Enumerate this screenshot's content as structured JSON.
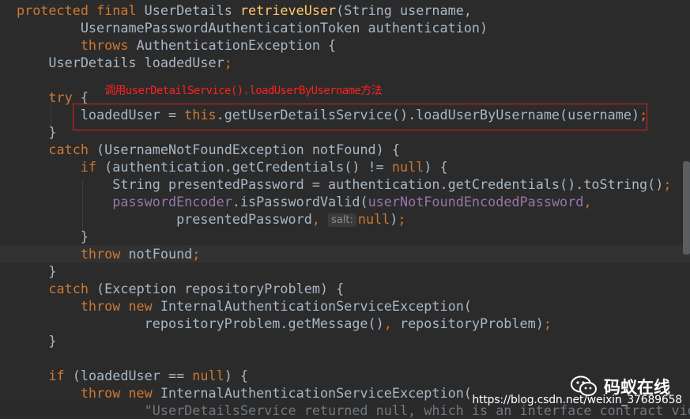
{
  "annotation": "调用userDetailService().loadUserByUsername方法",
  "brand": {
    "name": "码蚁在线",
    "icon": "wechat-icon"
  },
  "watermark": "https://blog.csdn.net/weixin_37689658",
  "colors": {
    "keyword": "#cc7832",
    "method_decl": "#ffc66d",
    "field": "#9876aa",
    "text": "#a9b7c6",
    "highlight_box": "#e02020"
  },
  "code": [
    {
      "segs": [
        {
          "t": "protected final ",
          "c": "kw"
        },
        {
          "t": "UserDetails "
        },
        {
          "t": "retrieveUser",
          "c": "fn"
        },
        {
          "t": "(String username,"
        }
      ]
    },
    {
      "segs": [
        {
          "t": "        UsernamePasswordAuthenticationToken authentication)"
        }
      ]
    },
    {
      "segs": [
        {
          "t": "        "
        },
        {
          "t": "throws ",
          "c": "kw"
        },
        {
          "t": "AuthenticationException {"
        }
      ]
    },
    {
      "segs": [
        {
          "t": "    UserDetails loadedUser"
        },
        {
          "t": ";",
          "c": "kw"
        }
      ]
    },
    {
      "segs": [
        {
          "t": ""
        }
      ]
    },
    {
      "segs": [
        {
          "t": "    "
        },
        {
          "t": "try ",
          "c": "kw"
        },
        {
          "t": "{"
        }
      ]
    },
    {
      "segs": [
        {
          "t": "        loadedUser = "
        },
        {
          "t": "this",
          "c": "kw"
        },
        {
          "t": ".getUserDetailsService().loadUserByUsername(username)"
        },
        {
          "t": ";",
          "c": "kw"
        }
      ]
    },
    {
      "segs": [
        {
          "t": "    }"
        }
      ]
    },
    {
      "segs": [
        {
          "t": "    "
        },
        {
          "t": "catch ",
          "c": "kw"
        },
        {
          "t": "(UsernameNotFoundException notFound) {"
        }
      ]
    },
    {
      "segs": [
        {
          "t": "        "
        },
        {
          "t": "if ",
          "c": "kw"
        },
        {
          "t": "(authentication.getCredentials() != "
        },
        {
          "t": "null",
          "c": "kw"
        },
        {
          "t": ") {"
        }
      ]
    },
    {
      "segs": [
        {
          "t": "            String presentedPassword = authentication.getCredentials().toString()"
        },
        {
          "t": ";",
          "c": "kw"
        }
      ]
    },
    {
      "segs": [
        {
          "t": "            "
        },
        {
          "t": "passwordEncoder",
          "c": "fld"
        },
        {
          "t": ".isPasswordValid("
        },
        {
          "t": "userNotFoundEncodedPassword",
          "c": "fld"
        },
        {
          "t": ",",
          "c": "kw"
        }
      ]
    },
    {
      "segs": [
        {
          "t": "                    presentedPassword"
        },
        {
          "t": ", ",
          "c": "kw"
        },
        {
          "t": "salt:",
          "c": "hint"
        },
        {
          "t": "null",
          "c": "kw"
        },
        {
          "t": ")"
        },
        {
          "t": ";",
          "c": "kw"
        }
      ]
    },
    {
      "segs": [
        {
          "t": "        }"
        }
      ]
    },
    {
      "segs": [
        {
          "t": "        "
        },
        {
          "t": "throw ",
          "c": "kw"
        },
        {
          "t": "notFound"
        },
        {
          "t": ";",
          "c": "kw"
        }
      ]
    },
    {
      "segs": [
        {
          "t": "    }"
        }
      ]
    },
    {
      "segs": [
        {
          "t": "    "
        },
        {
          "t": "catch ",
          "c": "kw"
        },
        {
          "t": "(Exception repositoryProblem) {"
        }
      ]
    },
    {
      "segs": [
        {
          "t": "        "
        },
        {
          "t": "throw new ",
          "c": "kw"
        },
        {
          "t": "InternalAuthenticationServiceException("
        }
      ]
    },
    {
      "segs": [
        {
          "t": "                repositoryProblem.getMessage()"
        },
        {
          "t": ", ",
          "c": "kw"
        },
        {
          "t": "repositoryProblem)"
        },
        {
          "t": ";",
          "c": "kw"
        }
      ]
    },
    {
      "segs": [
        {
          "t": "    }"
        }
      ]
    },
    {
      "segs": [
        {
          "t": ""
        }
      ]
    },
    {
      "segs": [
        {
          "t": "    "
        },
        {
          "t": "if ",
          "c": "kw"
        },
        {
          "t": "(loadedUser == "
        },
        {
          "t": "null",
          "c": "kw"
        },
        {
          "t": ") {"
        }
      ]
    },
    {
      "segs": [
        {
          "t": "        "
        },
        {
          "t": "throw new ",
          "c": "kw"
        },
        {
          "t": "InternalAuthenticationServiceException("
        }
      ]
    },
    {
      "segs": [
        {
          "t": "                \"UserDetailsService returned null, which is an interface contract vio"
        }
      ]
    }
  ]
}
